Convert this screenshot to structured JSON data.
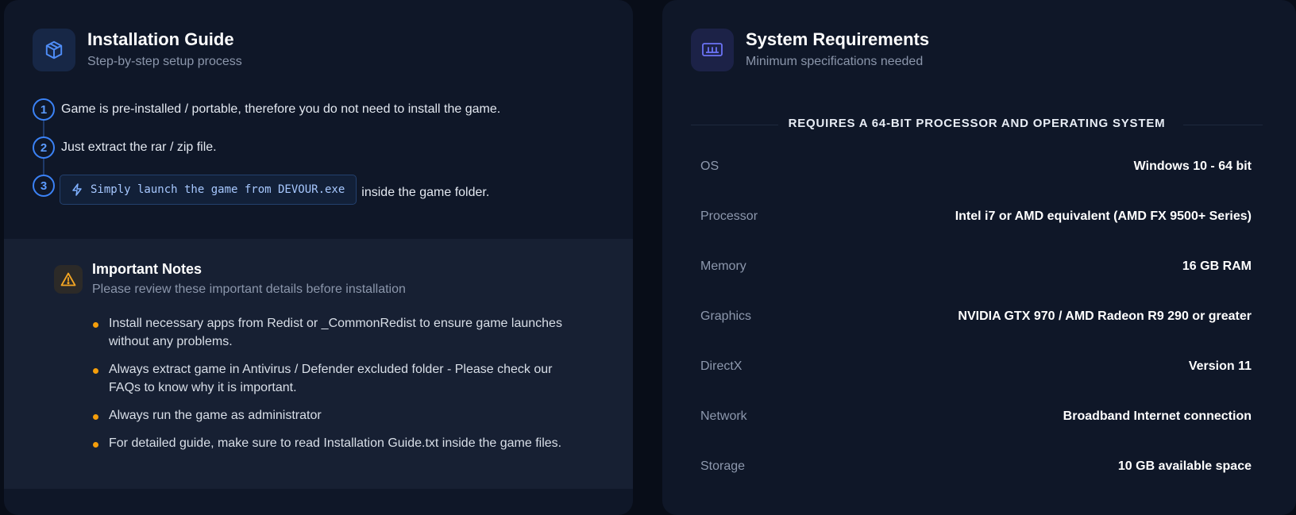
{
  "colors": {
    "page_bg": "#080d18",
    "card_bg": "#0f1728",
    "notes_bg": "#172033",
    "accent_blue": "#3b82f6",
    "accent_amber": "#f59e0b",
    "accent_indigo": "#6366f1"
  },
  "install": {
    "icon": "cube-icon",
    "title": "Installation Guide",
    "subtitle": "Step-by-step setup process",
    "steps": [
      {
        "num": "1",
        "text": "Game is pre-installed / portable, therefore you do not need to install the game."
      },
      {
        "num": "2",
        "text": "Just extract the rar / zip file."
      },
      {
        "num": "3",
        "code_icon": "lightning-icon",
        "code": "Simply launch the game from DEVOUR.exe",
        "after": "inside the game folder."
      }
    ]
  },
  "notes": {
    "icon": "warning-triangle-icon",
    "title": "Important Notes",
    "subtitle": "Please review these important details before installation",
    "items": [
      "Install necessary apps from Redist or _CommonRedist to ensure game launches without any problems.",
      "Always extract game in Antivirus / Defender excluded folder - Please check our FAQs to know why it is important.",
      "Always run the game as administrator",
      "For detailed guide, make sure to read Installation Guide.txt inside the game files."
    ]
  },
  "requirements": {
    "icon": "monitor-chart-icon",
    "title": "System Requirements",
    "subtitle": "Minimum specifications needed",
    "banner": "REQUIRES A 64-BIT PROCESSOR AND OPERATING SYSTEM",
    "rows": [
      {
        "label": "OS",
        "value": "Windows 10 - 64 bit"
      },
      {
        "label": "Processor",
        "value": "Intel i7 or AMD equivalent (AMD FX 9500+ Series)"
      },
      {
        "label": "Memory",
        "value": "16 GB RAM"
      },
      {
        "label": "Graphics",
        "value": "NVIDIA GTX 970 / AMD Radeon R9 290 or greater"
      },
      {
        "label": "DirectX",
        "value": "Version 11"
      },
      {
        "label": "Network",
        "value": "Broadband Internet connection"
      },
      {
        "label": "Storage",
        "value": "10 GB available space"
      }
    ]
  }
}
